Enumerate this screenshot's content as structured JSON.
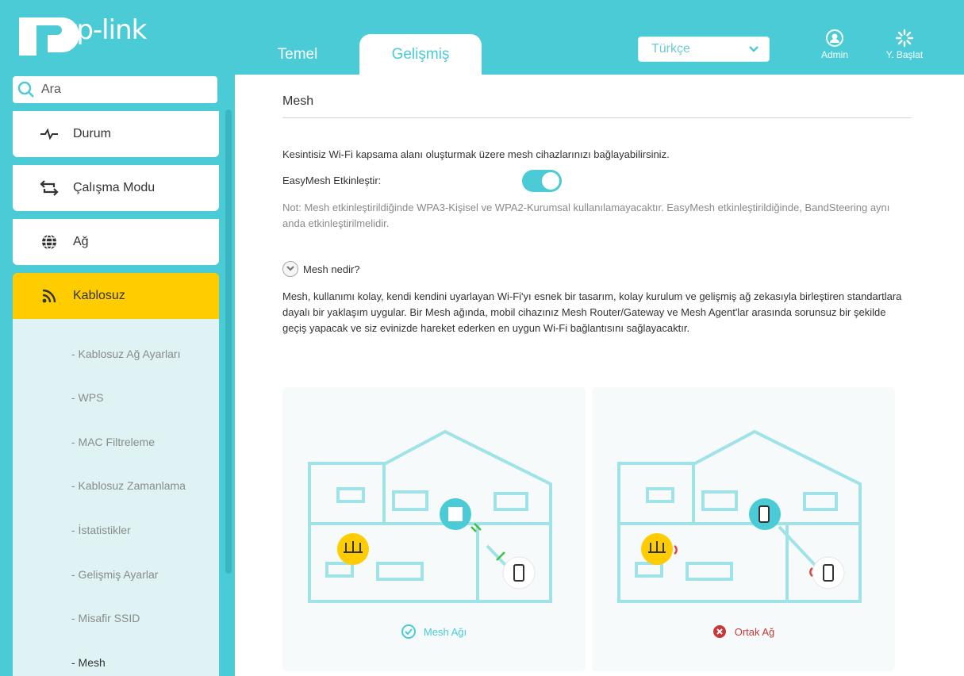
{
  "header": {
    "logo_text": "tp-link",
    "tabs": [
      {
        "label": "Temel"
      },
      {
        "label": "Gelişmiş"
      }
    ],
    "language": "Türkçe",
    "admin_label": "Admin",
    "reboot_label": "Y. Başlat"
  },
  "sidebar": {
    "search_placeholder": "Ara",
    "items": [
      {
        "label": "Durum",
        "icon": "pulse-icon"
      },
      {
        "label": "Çalışma Modu",
        "icon": "mode-switch-icon"
      },
      {
        "label": "Ağ",
        "icon": "globe-icon"
      },
      {
        "label": "Kablosuz",
        "icon": "wifi-icon",
        "active": true
      }
    ],
    "subitems": [
      {
        "label": "- Kablosuz Ağ Ayarları"
      },
      {
        "label": "- WPS"
      },
      {
        "label": "- MAC Filtreleme"
      },
      {
        "label": "- Kablosuz Zamanlama"
      },
      {
        "label": "- İstatistikler"
      },
      {
        "label": "- Gelişmiş Ayarlar"
      },
      {
        "label": "- Misafir SSID"
      },
      {
        "label": "- Mesh",
        "active": true
      }
    ]
  },
  "main": {
    "title": "Mesh",
    "description": "Kesintisiz Wi-Fi kapsama alanı oluşturmak üzere mesh cihazlarınızı bağlayabilirsiniz.",
    "easymesh_label": "EasyMesh Etkinleştir:",
    "easymesh_enabled": true,
    "note": "Not: Mesh etkinleştirildiğinde WPA3-Kişisel ve WPA2-Kurumsal kullanılamayacaktır. EasyMesh etkinleştirildiğinde, BandSteering aynı anda etkinleştirilmelidir.",
    "what_is_mesh": "Mesh nedir?",
    "explanation": "Mesh, kullanımı kolay, kendi kendini uyarlayan Wi-Fi'yı esnek bir tasarım, kolay kurulum ve gelişmiş ağ zekasıyla birleştiren standartlara dayalı bir yaklaşım uygular. Bir Mesh ağında, mobil cihazınız Mesh Router/Gateway ve Mesh Agent'lar arasında sorunsuz bir şekilde geçiş yapacak ve siz evinizde hareket ederken en uygun Wi-Fi bağlantısını sağlayacaktır.",
    "cards": [
      {
        "caption": "Mesh Ağı",
        "status": "good"
      },
      {
        "caption": "Ortak Ağ",
        "status": "bad"
      }
    ]
  },
  "colors": {
    "accent": "#4acbd6",
    "active_menu": "#ffcc00",
    "error": "#c43a3a"
  }
}
